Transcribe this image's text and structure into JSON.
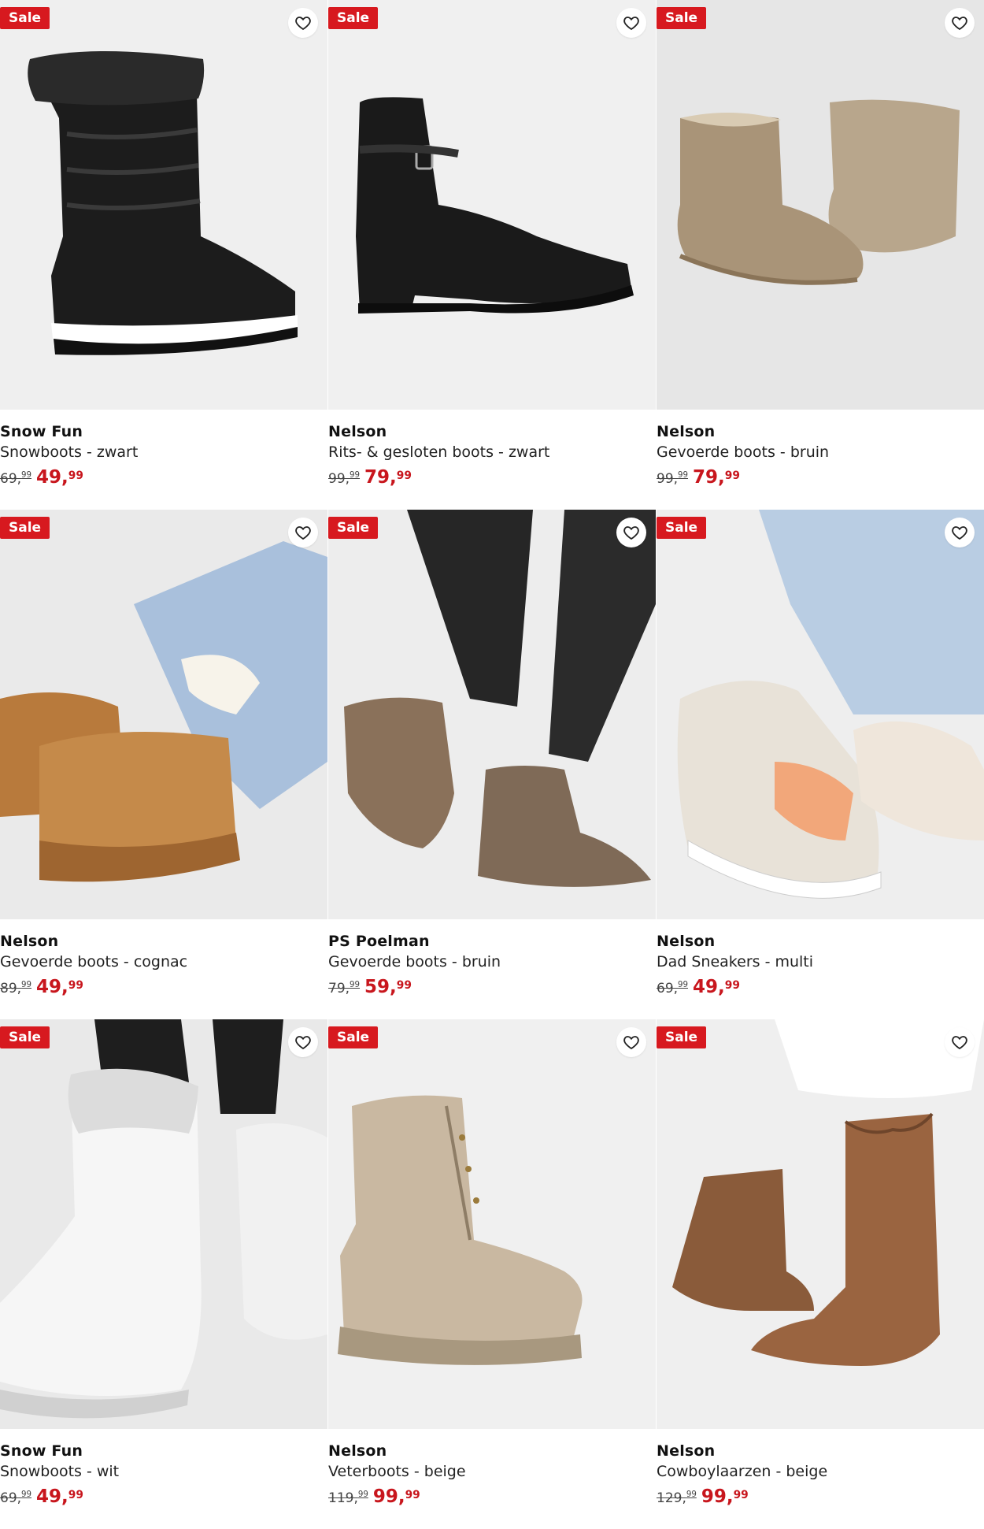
{
  "sale_label": "Sale",
  "products": [
    {
      "brand": "Snow Fun",
      "name": "Snowboots - zwart",
      "old_int": "69,",
      "old_dec": "99",
      "new_int": "49,",
      "new_dec": "99",
      "icon": "black-snowboot-image"
    },
    {
      "brand": "Nelson",
      "name": "Rits- & gesloten boots - zwart",
      "old_int": "99,",
      "old_dec": "99",
      "new_int": "79,",
      "new_dec": "99",
      "icon": "black-ankle-boot-image"
    },
    {
      "brand": "Nelson",
      "name": "Gevoerde boots - bruin",
      "old_int": "99,",
      "old_dec": "99",
      "new_int": "79,",
      "new_dec": "99",
      "icon": "brown-lined-boots-image"
    },
    {
      "brand": "Nelson",
      "name": "Gevoerde boots - cognac",
      "old_int": "89,",
      "old_dec": "99",
      "new_int": "49,",
      "new_dec": "99",
      "icon": "cognac-lined-boots-image"
    },
    {
      "brand": "PS Poelman",
      "name": "Gevoerde boots - bruin",
      "old_int": "79,",
      "old_dec": "99",
      "new_int": "59,",
      "new_dec": "99",
      "icon": "brown-lined-boots-worn-image"
    },
    {
      "brand": "Nelson",
      "name": "Dad Sneakers - multi",
      "old_int": "69,",
      "old_dec": "99",
      "new_int": "49,",
      "new_dec": "99",
      "icon": "dad-sneakers-image"
    },
    {
      "brand": "Snow Fun",
      "name": "Snowboots - wit",
      "old_int": "69,",
      "old_dec": "99",
      "new_int": "49,",
      "new_dec": "99",
      "icon": "white-snowboot-image"
    },
    {
      "brand": "Nelson",
      "name": "Veterboots - beige",
      "old_int": "119,",
      "old_dec": "99",
      "new_int": "99,",
      "new_dec": "99",
      "icon": "beige-lace-boot-image"
    },
    {
      "brand": "Nelson",
      "name": "Cowboylaarzen - beige",
      "old_int": "129,",
      "old_dec": "99",
      "new_int": "99,",
      "new_dec": "99",
      "icon": "cowboy-boots-image"
    }
  ],
  "colors": {
    "sale_red": "#d7191f",
    "price_red": "#c8161d"
  }
}
